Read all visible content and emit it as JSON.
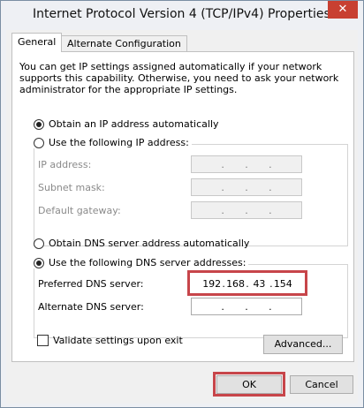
{
  "window": {
    "title": "Internet Protocol Version 4 (TCP/IPv4) Properties",
    "close_glyph": "✕"
  },
  "tabs": [
    {
      "label": "General",
      "active": true
    },
    {
      "label": "Alternate Configuration",
      "active": false
    }
  ],
  "info_text": "You can get IP settings assigned automatically if your network supports this capability. Otherwise, you need to ask your network administrator for the appropriate IP settings.",
  "ip": {
    "auto_label": "Obtain an IP address automatically",
    "manual_label": "Use the following IP address:",
    "selected": "auto",
    "fields": [
      {
        "label": "IP address:",
        "octets": [
          "",
          "",
          "",
          ""
        ]
      },
      {
        "label": "Subnet mask:",
        "octets": [
          "",
          "",
          "",
          ""
        ]
      },
      {
        "label": "Default gateway:",
        "octets": [
          "",
          "",
          "",
          ""
        ]
      }
    ]
  },
  "dns": {
    "auto_label": "Obtain DNS server address automatically",
    "manual_label": "Use the following DNS server addresses:",
    "selected": "manual",
    "preferred": {
      "label": "Preferred DNS server:",
      "octets": [
        "192",
        "168",
        "43",
        "154"
      ]
    },
    "alternate": {
      "label": "Alternate DNS server:",
      "octets": [
        "",
        "",
        "",
        ""
      ]
    }
  },
  "validate": {
    "label": "Validate settings upon exit",
    "checked": false
  },
  "buttons": {
    "advanced": "Advanced...",
    "ok": "OK",
    "cancel": "Cancel"
  },
  "colors": {
    "highlight": "#c7454a",
    "close_button": "#c84031"
  }
}
